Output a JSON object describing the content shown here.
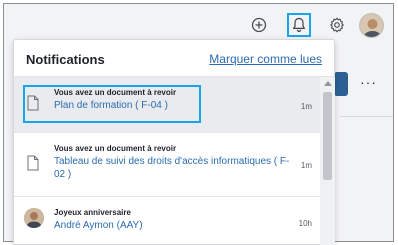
{
  "topbar": {
    "icons": [
      "plus-circle-icon",
      "bell-icon",
      "gear-icon",
      "user-avatar"
    ],
    "highlight_color": "#1aa3e8"
  },
  "background": {
    "more_label": "···"
  },
  "notifications": {
    "title": "Notifications",
    "mark_all_read": "Marquer comme lues",
    "items": [
      {
        "icon": "document-icon",
        "title": "Vous avez un document à revoir",
        "subtitle": "Plan de formation ( F-04 )",
        "time": "1m",
        "highlighted": true
      },
      {
        "icon": "document-icon",
        "title": "Vous avez un document à revoir",
        "subtitle": "Tableau de suivi des droits d'accès informatiques ( F-02 )",
        "time": "1m",
        "highlighted": false
      },
      {
        "icon": "user-avatar",
        "title": "Joyeux anniversaire",
        "subtitle": "André Aymon (AAY)",
        "time": "10h",
        "highlighted": false
      }
    ]
  },
  "colors": {
    "link": "#2b6cb0",
    "accent": "#1aa3e8",
    "primary_button": "#2c5f94"
  }
}
